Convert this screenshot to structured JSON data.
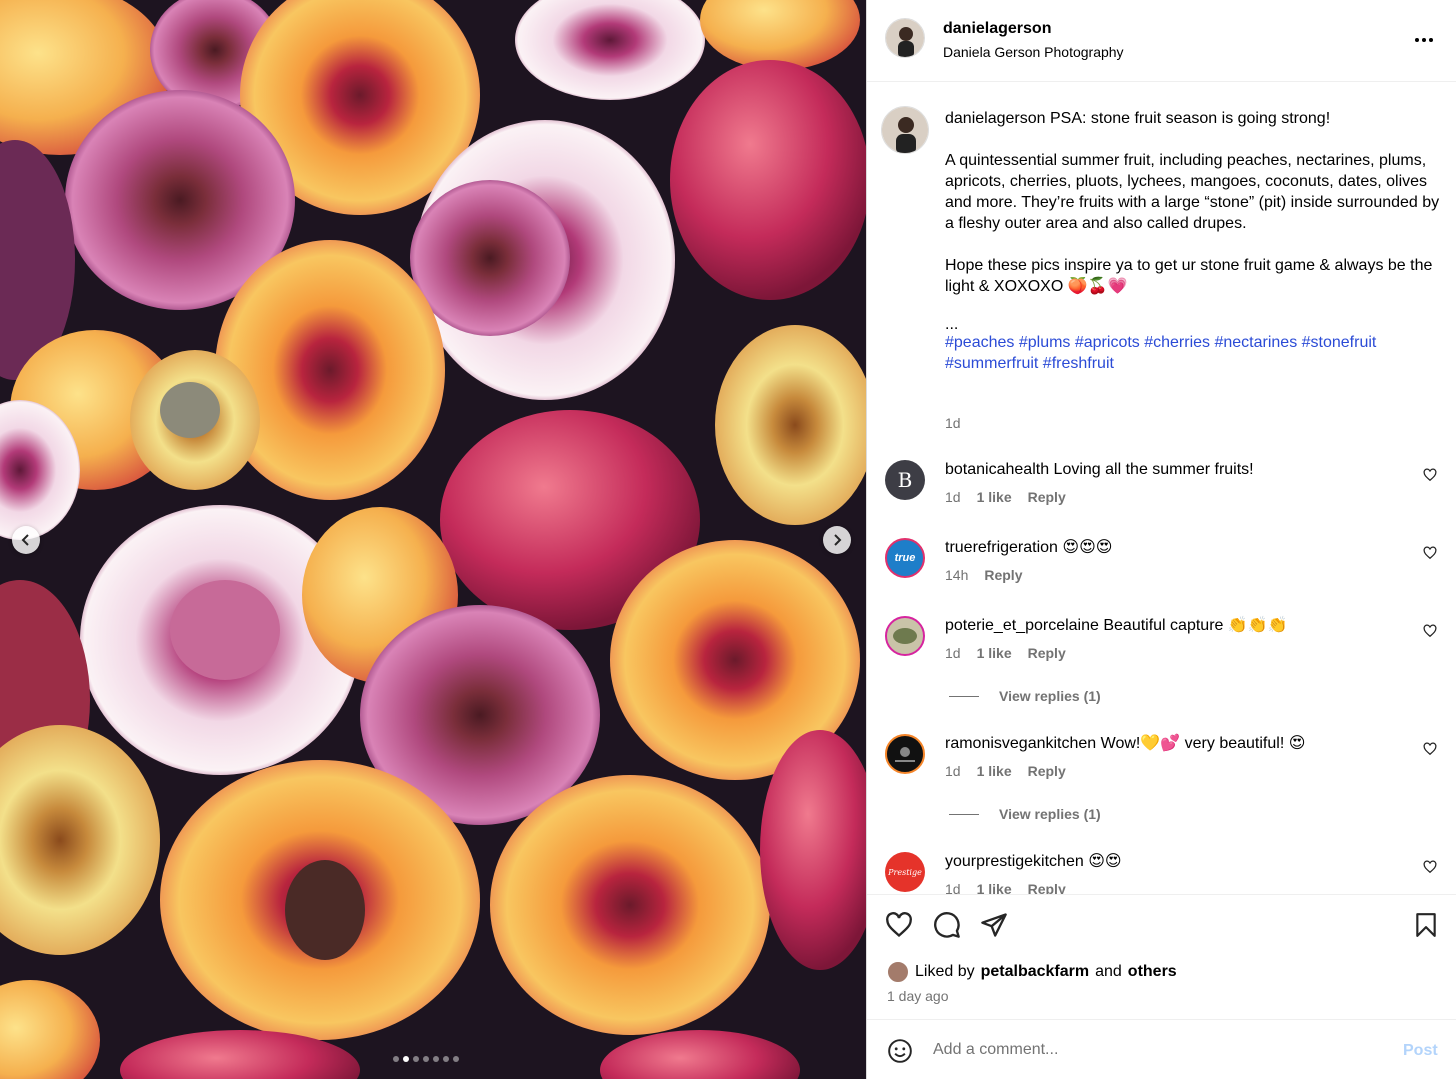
{
  "header": {
    "username": "danielagerson",
    "subtitle": "Daniela Gerson Photography"
  },
  "caption": {
    "username": "danielagerson",
    "line1": "PSA: stone fruit season is going strong!",
    "para2": "A quintessential summer fruit, including peaches, nectarines, plums, apricots, cherries, pluots, lychees, mangoes, coconuts, dates, olives and more. They’re fruits with a large “stone” (pit) inside surrounded by a fleshy outer area and also called drupes.",
    "para3": "Hope these pics inspire ya to get ur stone fruit game & always be the light & XOXOXO 🍑🍒💗",
    "ellipsis": "...",
    "hashtags": "#peaches #plums #apricots #cherries #nectarines #stonefruit #summerfruit #freshfruit",
    "time": "1d"
  },
  "comments": [
    {
      "username": "botanicahealth",
      "text": "Loving all the summer fruits!",
      "time": "1d",
      "likes": "1 like",
      "reply": "Reply",
      "avatar_color": "#3d3d45"
    },
    {
      "username": "truerefrigeration",
      "text": "😍😍😍",
      "time": "14h",
      "likes": "",
      "reply": "Reply",
      "avatar_color": "#1e7ec9"
    },
    {
      "username": "poterie_et_porcelaine",
      "text": "Beautiful capture 👏👏👏",
      "time": "1d",
      "likes": "1 like",
      "reply": "Reply",
      "avatar_color": "#c9c3a8",
      "view_replies": "View replies (1)"
    },
    {
      "username": "ramonisvegankitchen",
      "text": "Wow!💛💕 very beautiful! 😍",
      "time": "1d",
      "likes": "1 like",
      "reply": "Reply",
      "avatar_color": "#111111",
      "view_replies": "View replies (1)"
    },
    {
      "username": "yourprestigekitchen",
      "text": "😍😍",
      "time": "1d",
      "likes": "1 like",
      "reply": "Reply",
      "avatar_color": "#e5332a"
    }
  ],
  "avatar_labels": {
    "botanica": "B",
    "true": "true",
    "prestige": "Prestige"
  },
  "likes": {
    "prefix": "Liked by",
    "user": "petalbackfarm",
    "middle": "and",
    "suffix": "others",
    "ago": "1 day ago"
  },
  "add_comment": {
    "placeholder": "Add a comment...",
    "post_label": "Post"
  },
  "carousel": {
    "slides": 7,
    "current": 2
  },
  "icons": [
    "chevron-left-icon",
    "chevron-right-icon",
    "more-icon",
    "heart-icon",
    "comment-icon",
    "share-icon",
    "bookmark-icon",
    "emoji-icon"
  ],
  "colors": {
    "link": "#2b4bd6",
    "muted": "#737373",
    "post_button": "#b3d4fb"
  }
}
